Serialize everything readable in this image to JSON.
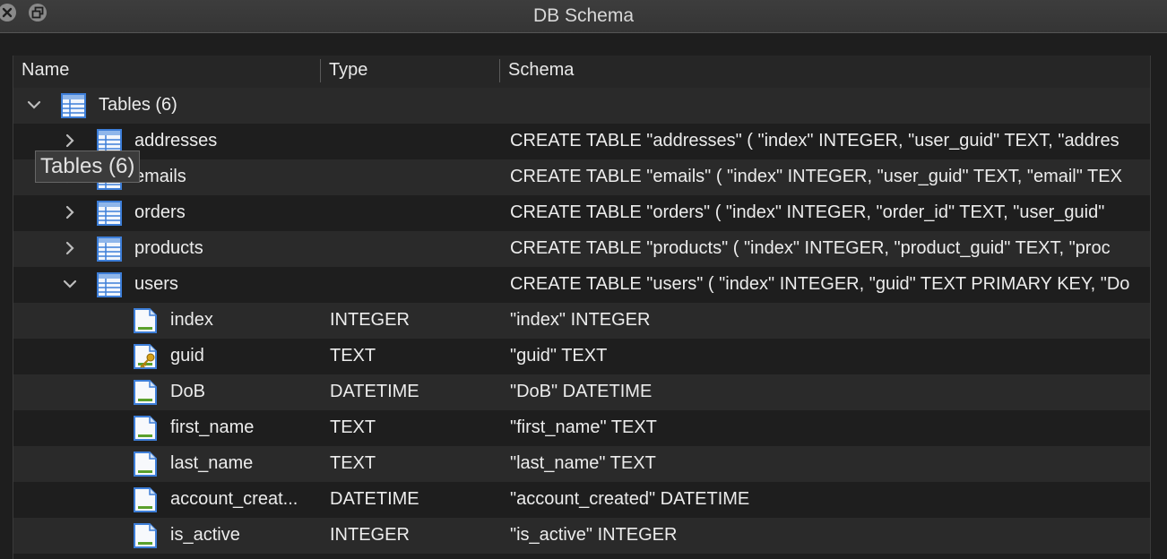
{
  "window": {
    "title": "DB Schema",
    "close_icon": "close-icon",
    "float_icon": "float-window-icon"
  },
  "columns": {
    "name": "Name",
    "type": "Type",
    "schema": "Schema"
  },
  "tables_group": {
    "label": "Tables (6)"
  },
  "tables": [
    {
      "name": "addresses",
      "schema": "CREATE TABLE \"addresses\" ( \"index\" INTEGER, \"user_guid\" TEXT, \"addres"
    },
    {
      "name": "emails",
      "schema": "CREATE TABLE \"emails\" ( \"index\" INTEGER, \"user_guid\" TEXT, \"email\" TEX"
    },
    {
      "name": "orders",
      "schema": "CREATE TABLE \"orders\" ( \"index\" INTEGER, \"order_id\" TEXT, \"user_guid\""
    },
    {
      "name": "products",
      "schema": "CREATE TABLE \"products\" ( \"index\" INTEGER, \"product_guid\" TEXT, \"proc"
    },
    {
      "name": "users",
      "schema": "CREATE TABLE \"users\" ( \"index\" INTEGER, \"guid\" TEXT PRIMARY KEY, \"Do"
    }
  ],
  "users_fields": [
    {
      "name": "index",
      "type": "INTEGER",
      "schema": "\"index\" INTEGER",
      "key": false
    },
    {
      "name": "guid",
      "type": "TEXT",
      "schema": "\"guid\" TEXT",
      "key": true
    },
    {
      "name": "DoB",
      "type": "DATETIME",
      "schema": "\"DoB\" DATETIME",
      "key": false
    },
    {
      "name": "first_name",
      "type": "TEXT",
      "schema": "\"first_name\" TEXT",
      "key": false
    },
    {
      "name": "last_name",
      "type": "TEXT",
      "schema": "\"last_name\" TEXT",
      "key": false
    },
    {
      "name": "account_creat...",
      "type": "DATETIME",
      "schema": "\"account_created\" DATETIME",
      "key": false
    },
    {
      "name": "is_active",
      "type": "INTEGER",
      "schema": "\"is_active\" INTEGER",
      "key": false
    }
  ],
  "tooltip": {
    "text": "Tables (6)"
  },
  "colors": {
    "background": "#1e1e1e",
    "alt_row": "#2a2a2a",
    "table_icon_blue": "#3d7ed8",
    "field_icon_green": "#5aa02c",
    "key_icon_gold": "#d8a21a"
  }
}
